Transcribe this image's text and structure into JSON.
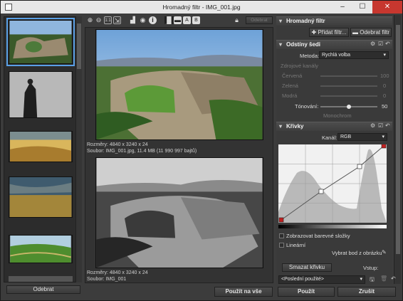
{
  "window": {
    "title": "Hromadný filtr - IMG_001.jpg"
  },
  "thumbs": {
    "remove_label": "Odebrat"
  },
  "toolbar": {
    "disabled_label": "Odebrat"
  },
  "preview": {
    "top_info_1": "Rozměry: 4840 x 3240 x 24",
    "top_info_2": "Soubor: IMG_001.jpg, 11.4 MB (11 990 997 bajtů)",
    "bottom_info_1": "Rozměry: 4840 x 3240 x 24",
    "bottom_info_2": "Soubor: IMG_001"
  },
  "panel": {
    "section_title": "Hromadný filtr",
    "add_filter": "Přidat filtr...",
    "remove_filter": "Odebrat filtr",
    "gray": {
      "title": "Odstíny šedi",
      "method_label": "Metoda:",
      "method_value": "Rychlá volba",
      "faded_group": "Zdrojové kanály",
      "red_label": "Červená",
      "red_value": "100",
      "green_label": "Zelená",
      "green_value": "0",
      "blue_label": "Modrá",
      "blue_value": "0",
      "tone_label": "Tónování:",
      "tone_value": "50",
      "tone_fraction": 0.5,
      "faded_check": "Monochrom"
    },
    "curves": {
      "title": "Křivky",
      "channel_label": "Kanál:",
      "channel_value": "RGB",
      "show_color": "Zobrazovat barevné složky",
      "linear": "Lineární",
      "pick_point": "Vybrat bod z obrázku",
      "delete_curve": "Smazat křivku",
      "input_label": "Vstup:",
      "preset_value": "<Poslední použité>"
    }
  },
  "bottom": {
    "apply_all": "Použít na vše",
    "apply": "Použít",
    "cancel": "Zrušit"
  },
  "colors": {
    "accent": "#5aa0e6",
    "close": "#c7372f"
  }
}
